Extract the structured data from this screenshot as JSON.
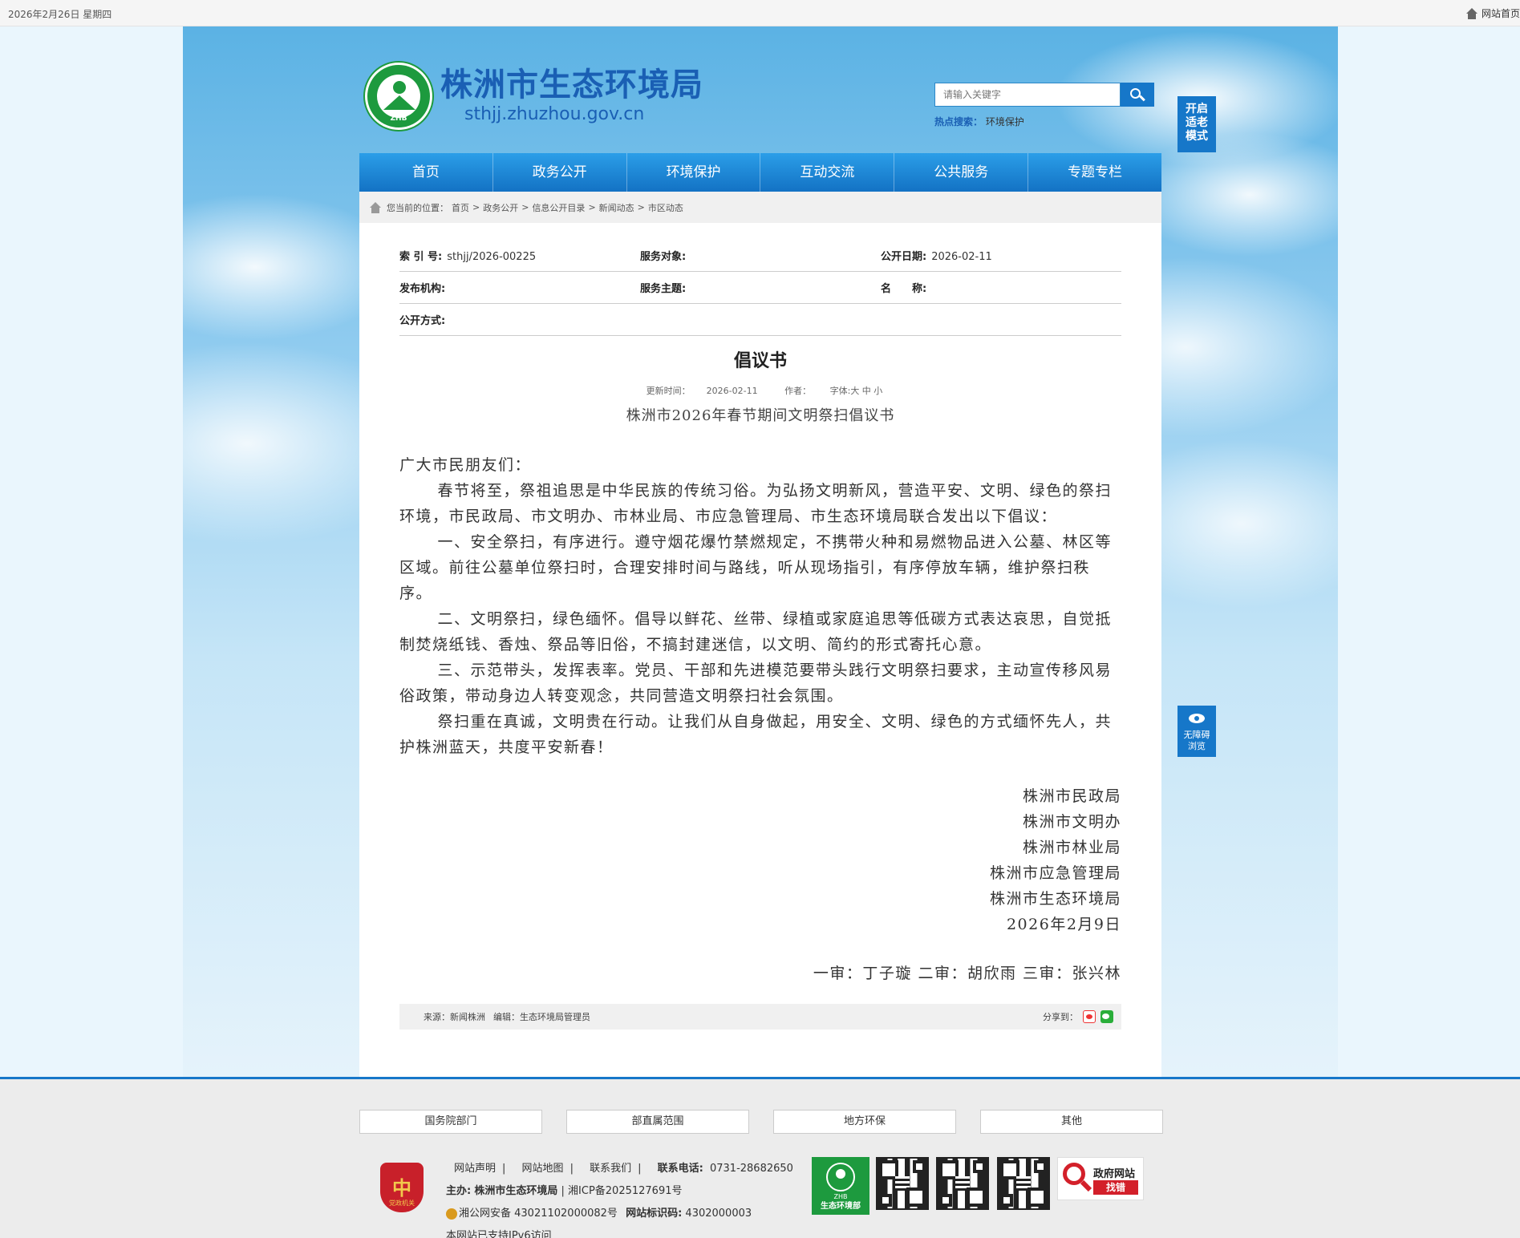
{
  "topbar": {
    "date": "2026年2月26日 星期四",
    "home_link": "网站首页"
  },
  "header": {
    "logo_badge": "ZHB",
    "site_title": "株洲市生态环境局",
    "site_url": "sthjj.zhuzhou.gov.cn",
    "search_placeholder": "请输入关键字",
    "hot_label": "热点搜索：",
    "hot_term": "环境保护",
    "elder_mode": "开启\n适老\n模式"
  },
  "nav": [
    "首页",
    "政务公开",
    "环境保护",
    "互动交流",
    "公共服务",
    "专题专栏"
  ],
  "breadcrumb": {
    "prefix": "您当前的位置：",
    "items": [
      "首页",
      "政务公开",
      "信息公开目录",
      "新闻动态",
      "市区动态"
    ],
    "sep": ">"
  },
  "meta": {
    "index_label": "索 引 号:",
    "index_value": "sthjj/2026-00225",
    "target_label": "服务对象:",
    "target_value": "",
    "date_label": "公开日期:",
    "date_value": "2026-02-11",
    "org_label": "发布机构:",
    "org_value": "",
    "topic_label": "服务主题:",
    "topic_value": "",
    "name_label": "名　　称:",
    "name_value": "",
    "method_label": "公开方式:",
    "method_value": ""
  },
  "article": {
    "title": "倡议书",
    "update_label": "更新时间：",
    "update_value": "2026-02-11",
    "author_label": "作者：",
    "font_label": "字体:大 中 小",
    "subtitle": "株洲市2026年春节期间文明祭扫倡议书",
    "greeting": "广大市民朋友们：",
    "paragraphs": [
      "春节将至，祭祖追思是中华民族的传统习俗。为弘扬文明新风，营造平安、文明、绿色的祭扫环境，市民政局、市文明办、市林业局、市应急管理局、市生态环境局联合发出以下倡议：",
      "一、安全祭扫，有序进行。遵守烟花爆竹禁燃规定，不携带火种和易燃物品进入公墓、林区等区域。前往公墓单位祭扫时，合理安排时间与路线，听从现场指引，有序停放车辆，维护祭扫秩序。",
      "二、文明祭扫，绿色缅怀。倡导以鲜花、丝带、绿植或家庭追思等低碳方式表达哀思，自觉抵制焚烧纸钱、香烛、祭品等旧俗，不搞封建迷信，以文明、简约的形式寄托心意。",
      "三、示范带头，发挥表率。党员、干部和先进模范要带头践行文明祭扫要求，主动宣传移风易俗政策，带动身边人转变观念，共同营造文明祭扫社会氛围。",
      "祭扫重在真诚，文明贵在行动。让我们从自身做起，用安全、文明、绿色的方式缅怀先人，共护株洲蓝天，共度平安新春！"
    ],
    "signatures": [
      "株洲市民政局",
      "株洲市文明办",
      "株洲市林业局",
      "株洲市应急管理局",
      "株洲市生态环境局",
      "2026年2月9日"
    ],
    "review": "一审：丁子璇 二审：胡欣雨 三审：张兴林",
    "source": "来源：新闻株洲",
    "editor": "编辑：生态环境局管理员",
    "share_label": "分享到："
  },
  "access_button": "无障碍\n浏览",
  "footer": {
    "links": [
      "国务院部门",
      "部直属范围",
      "地方环保",
      "其他"
    ],
    "badge_glyph": "中",
    "badge_text": "党政机关",
    "line1": [
      "网站声明",
      "网站地图",
      "联系我们"
    ],
    "phone_label": "联系电话:",
    "phone": "0731-28682650",
    "host_label": "主办:",
    "host": "株洲市生态环境局",
    "icp": "湘ICP备2025127691号",
    "police": "湘公网安备 43021102000082号",
    "site_id_label": "网站标识码:",
    "site_id": "4302000003",
    "ipv6": "本网站已支持IPv6访问",
    "zhb_logo_top": "ZHB",
    "zhb_logo_bottom": "生态环境部",
    "jiucuo_top": "政府网站",
    "jiucuo_bottom": "找错"
  }
}
